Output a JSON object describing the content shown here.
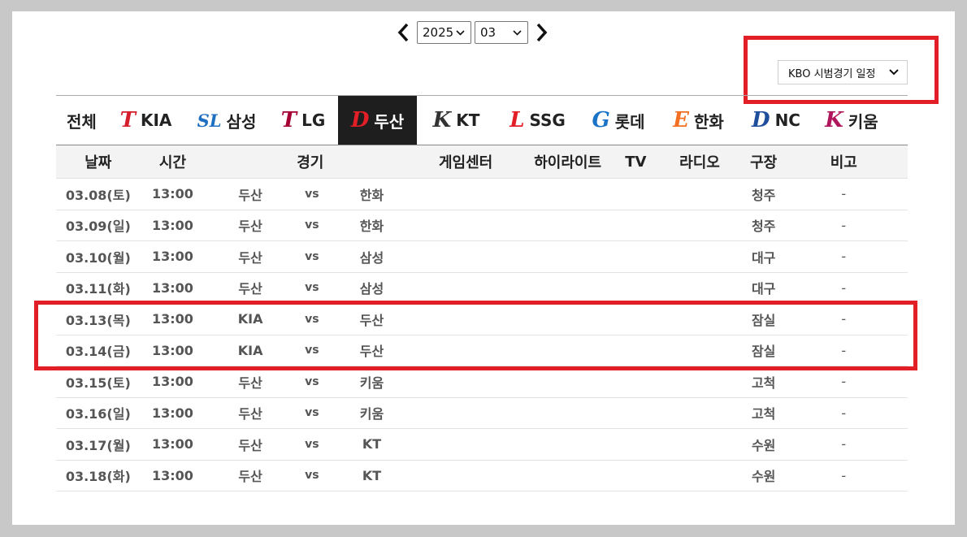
{
  "nav": {
    "year": "2025",
    "month": "03"
  },
  "series_select": "KBO 시범경기 일정",
  "teams": [
    {
      "label": "전체",
      "logo": "",
      "logo_color": ""
    },
    {
      "label": "KIA",
      "logo": "T",
      "logo_color": "#d41e2b"
    },
    {
      "label": "삼성",
      "logo": "SL",
      "logo_color": "#1f6fc0"
    },
    {
      "label": "LG",
      "logo": "T",
      "logo_color": "#a50034"
    },
    {
      "label": "두산",
      "logo": "D",
      "logo_color": "#e21e26"
    },
    {
      "label": "KT",
      "logo": "K",
      "logo_color": "#333333"
    },
    {
      "label": "SSG",
      "logo": "L",
      "logo_color": "#e21e26"
    },
    {
      "label": "롯데",
      "logo": "G",
      "logo_color": "#1a73c7"
    },
    {
      "label": "한화",
      "logo": "E",
      "logo_color": "#f26f21"
    },
    {
      "label": "NC",
      "logo": "D",
      "logo_color": "#1f4e9c"
    },
    {
      "label": "키움",
      "logo": "K",
      "logo_color": "#b0155b"
    }
  ],
  "active_team": "두산",
  "table": {
    "headers": {
      "date": "날짜",
      "time": "시간",
      "match": "경기",
      "gamecenter": "게임센터",
      "highlight": "하이라이트",
      "tv": "TV",
      "radio": "라디오",
      "stadium": "구장",
      "note": "비고"
    },
    "rows": [
      {
        "date": "03.08(토)",
        "time": "13:00",
        "away": "두산",
        "vs": "vs",
        "home": "한화",
        "stadium": "청주",
        "note": "-"
      },
      {
        "date": "03.09(일)",
        "time": "13:00",
        "away": "두산",
        "vs": "vs",
        "home": "한화",
        "stadium": "청주",
        "note": "-"
      },
      {
        "date": "03.10(월)",
        "time": "13:00",
        "away": "두산",
        "vs": "vs",
        "home": "삼성",
        "stadium": "대구",
        "note": "-"
      },
      {
        "date": "03.11(화)",
        "time": "13:00",
        "away": "두산",
        "vs": "vs",
        "home": "삼성",
        "stadium": "대구",
        "note": "-"
      },
      {
        "date": "03.13(목)",
        "time": "13:00",
        "away": "KIA",
        "vs": "vs",
        "home": "두산",
        "stadium": "잠실",
        "note": "-"
      },
      {
        "date": "03.14(금)",
        "time": "13:00",
        "away": "KIA",
        "vs": "vs",
        "home": "두산",
        "stadium": "잠실",
        "note": "-"
      },
      {
        "date": "03.15(토)",
        "time": "13:00",
        "away": "두산",
        "vs": "vs",
        "home": "키움",
        "stadium": "고척",
        "note": "-"
      },
      {
        "date": "03.16(일)",
        "time": "13:00",
        "away": "두산",
        "vs": "vs",
        "home": "키움",
        "stadium": "고척",
        "note": "-"
      },
      {
        "date": "03.17(월)",
        "time": "13:00",
        "away": "두산",
        "vs": "vs",
        "home": "KT",
        "stadium": "수원",
        "note": "-"
      },
      {
        "date": "03.18(화)",
        "time": "13:00",
        "away": "두산",
        "vs": "vs",
        "home": "KT",
        "stadium": "수원",
        "note": "-"
      }
    ]
  },
  "colors": {
    "highlight_box": "#e21e26",
    "active_tab_bg": "#1e1e1e"
  }
}
